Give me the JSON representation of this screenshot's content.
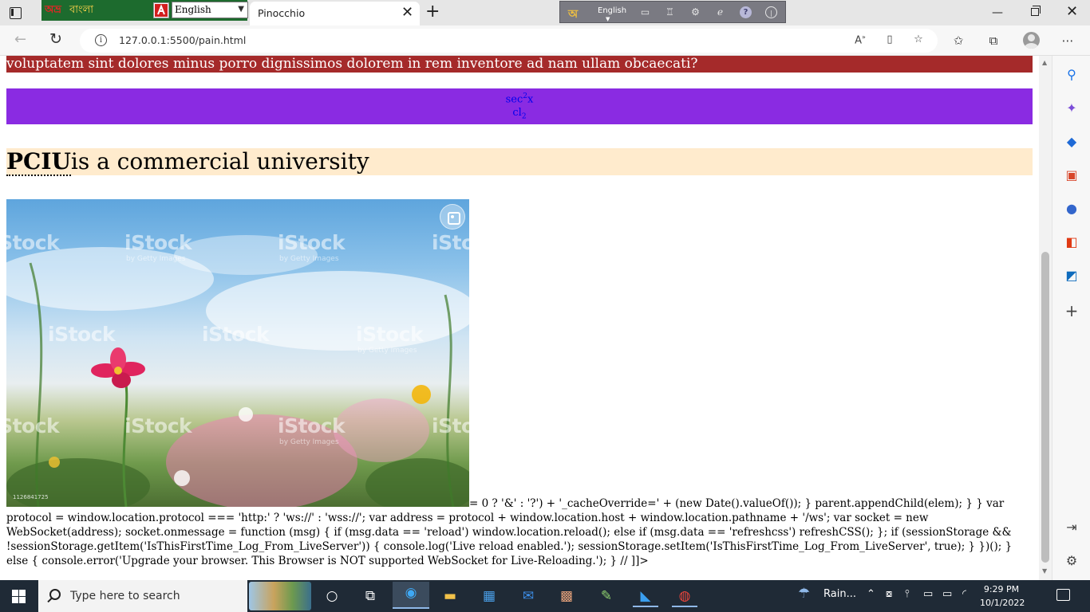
{
  "browser": {
    "tab_title": "Pinocchio",
    "url": "127.0.0.1:5500/pain.html"
  },
  "keyboard_widget": {
    "logo": "অভ্র",
    "name": "বাংলা",
    "language": "English"
  },
  "language_bar": {
    "language": "English"
  },
  "page": {
    "red_band_text": "voluptatem sint dolores minus porro dignissimos dolorem in rem inventore ad nam ullam obcaecati?",
    "formula_top_base": "sec",
    "formula_top_sup": "2",
    "formula_top_var": "x",
    "formula_bottom_base": "cl",
    "formula_bottom_sub": "2",
    "heading_abbr": "PCIU",
    "heading_rest": "is a commercial university",
    "image_watermark": "iStock",
    "image_watermark_sub": "by Getty Images",
    "image_stock_id": "1126841725",
    "script_text": "= 0 ? '&' : '?') + '_cacheOverride=' + (new Date().valueOf()); } parent.appendChild(elem); } } var protocol = window.location.protocol === 'http:' ? 'ws://' : 'wss://'; var address = protocol + window.location.host + window.location.pathname + '/ws'; var socket = new WebSocket(address); socket.onmessage = function (msg) { if (msg.data == 'reload') window.location.reload(); else if (msg.data == 'refreshcss') refreshCSS(); }; if (sessionStorage && !sessionStorage.getItem('IsThisFirstTime_Log_From_LiveServer')) { console.log('Live reload enabled.'); sessionStorage.setItem('IsThisFirstTime_Log_From_LiveServer', true); } })(); } else { console.error('Upgrade your browser. This Browser is NOT supported WebSocket for Live-Reloading.'); } // ]]>"
  },
  "taskbar": {
    "search_placeholder": "Type here to search",
    "weather": "Rain...",
    "time": "9:29 PM",
    "date": "10/1/2022"
  },
  "colors": {
    "red_band": "#a52a2a",
    "purple_box": "#8a2be2",
    "heading_band": "#ffebcd",
    "taskbar": "#1f2a36"
  }
}
